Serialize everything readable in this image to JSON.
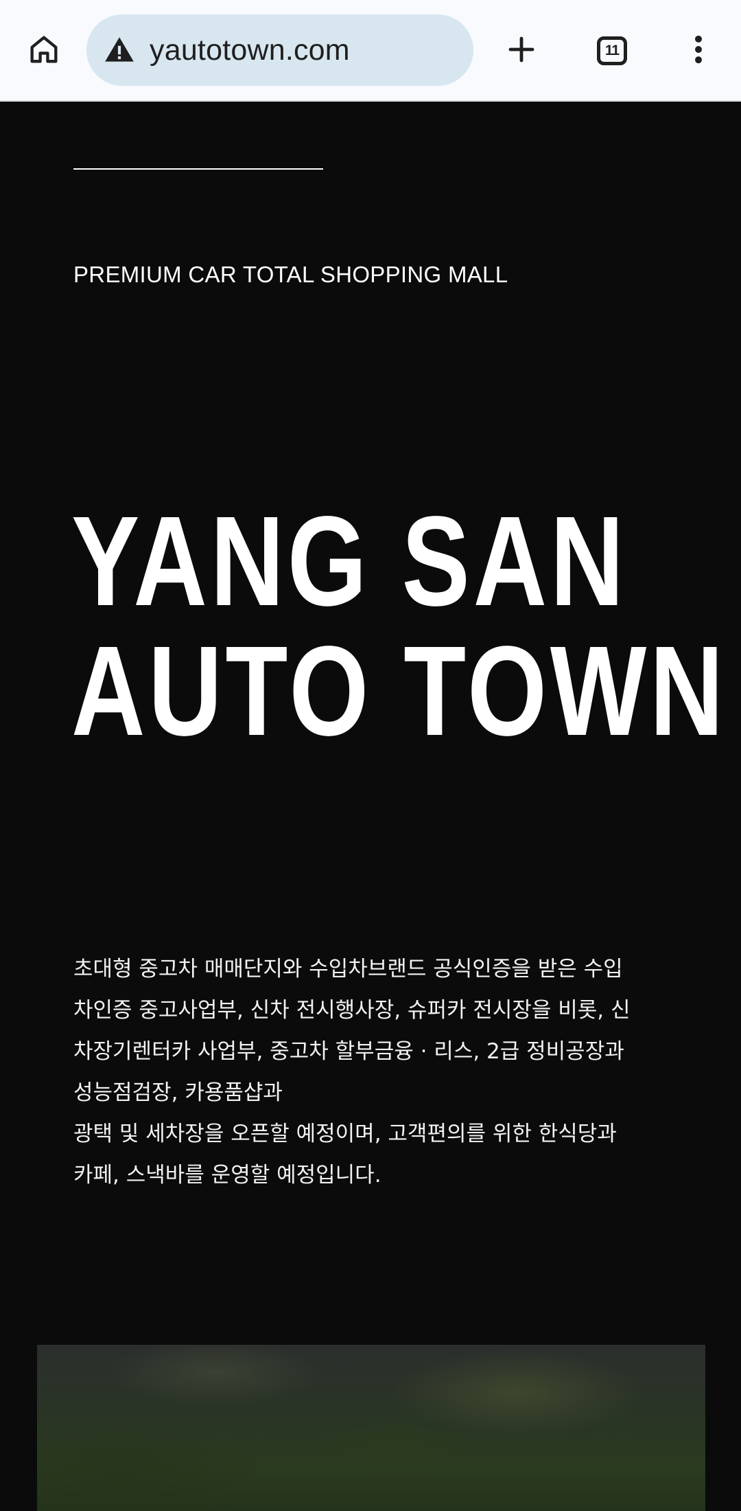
{
  "browser": {
    "url": "yautotown.com",
    "tab_count": "11",
    "icons": {
      "home": "home-icon",
      "warning": "warning-icon",
      "new_tab": "plus-icon",
      "tabs": "tab-switcher-icon",
      "menu": "more-vert-icon"
    }
  },
  "hero": {
    "tagline": "PREMIUM CAR TOTAL SHOPPING MALL",
    "title_line1": "YANG SAN",
    "title_line2": "AUTO TOWN"
  },
  "description": {
    "lines": [
      "초대형 중고차 매매단지와 수입차브랜드 공식인증을 받은 수입",
      "차인증 중고사업부, 신차 전시행사장, 슈퍼카 전시장을 비롯, 신",
      "차장기렌터카 사업부, 중고차 할부금융 · 리스, 2급 정비공장과",
      "성능점검장, 카용품샵과",
      "광택 및 세차장을 오픈할 예정이며, 고객편의를 위한 한식당과",
      "카페, 스낵바를 운영할 예정입니다."
    ]
  },
  "colors": {
    "page_background": "#0b0b0c",
    "toolbar_background": "#f8fafd",
    "url_bar_background": "#d8e6f0",
    "text_primary": "#ffffff"
  }
}
